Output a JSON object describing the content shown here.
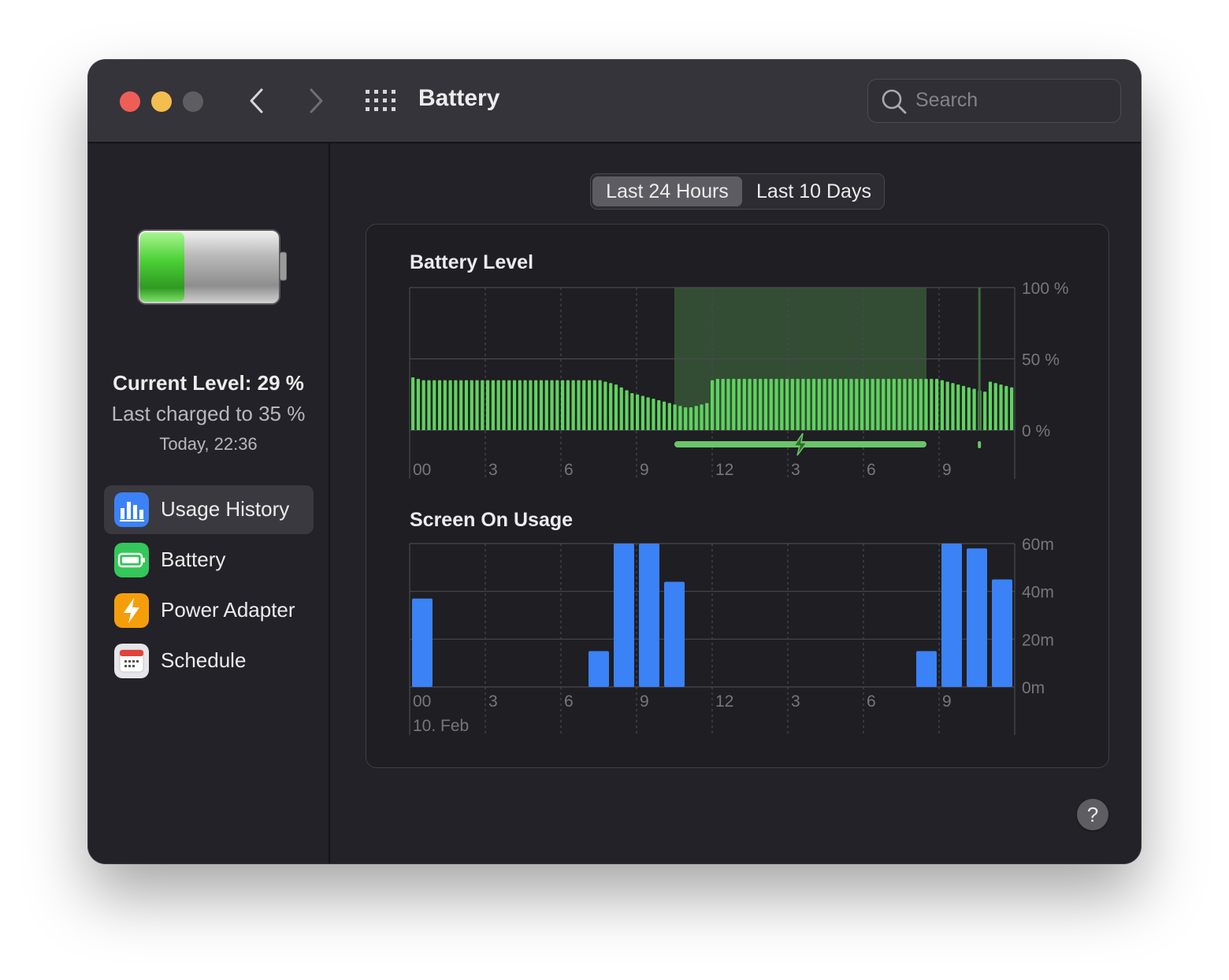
{
  "window": {
    "title": "Battery",
    "search_placeholder": "Search"
  },
  "sidebar": {
    "status": {
      "current_level": "Current Level: 29 %",
      "last_charged": "Last charged to 35 %",
      "charged_time": "Today, 22:36"
    },
    "items": [
      {
        "label": "Usage History",
        "icon": "usage-history-icon",
        "color": "#3b82f6",
        "active": true
      },
      {
        "label": "Battery",
        "icon": "battery-icon",
        "color": "#34c759"
      },
      {
        "label": "Power Adapter",
        "icon": "bolt-icon",
        "color": "#f59e0b"
      },
      {
        "label": "Schedule",
        "icon": "calendar-icon",
        "color": "#e5e5ea"
      }
    ]
  },
  "segmented": {
    "options": [
      "Last 24 Hours",
      "Last 10 Days"
    ],
    "selected": 0
  },
  "help_label": "?",
  "colors": {
    "battery_bar": "#5fd35f",
    "charging_band": "#334d34",
    "screen_bar": "#3a82f6",
    "grid": "#4a4950"
  },
  "chart_data": [
    {
      "type": "bar",
      "title": "Battery Level",
      "x_ticks": [
        "00",
        "3",
        "6",
        "9",
        "12",
        "3",
        "6",
        "9"
      ],
      "y_ticks": [
        "100 %",
        "50 %",
        "0 %"
      ],
      "ylim": [
        0,
        100
      ],
      "charging_span_hours": [
        10.5,
        20.5
      ],
      "charging_marker_hour": 22.6,
      "values_percent_every_quarter_hour": [
        37,
        36,
        35,
        35,
        35,
        35,
        35,
        35,
        35,
        35,
        35,
        35,
        35,
        35,
        35,
        35,
        35,
        35,
        35,
        35,
        35,
        35,
        35,
        35,
        35,
        35,
        35,
        35,
        35,
        35,
        35,
        35,
        35,
        35,
        35,
        35,
        34,
        33,
        32,
        30,
        28,
        26,
        25,
        24,
        23,
        22,
        21,
        20,
        19,
        18,
        17,
        16,
        16,
        17,
        18,
        19,
        35,
        36,
        36,
        36,
        36,
        36,
        36,
        36,
        36,
        36,
        36,
        36,
        36,
        36,
        36,
        36,
        36,
        36,
        36,
        36,
        36,
        36,
        36,
        36,
        36,
        36,
        36,
        36,
        36,
        36,
        36,
        36,
        36,
        36,
        36,
        36,
        36,
        36,
        36,
        36,
        36,
        36,
        36,
        35,
        34,
        33,
        32,
        31,
        30,
        29,
        28,
        27,
        34,
        33,
        32,
        31,
        30
      ]
    },
    {
      "type": "bar",
      "title": "Screen On Usage",
      "x_ticks": [
        "00",
        "3",
        "6",
        "9",
        "12",
        "3",
        "6",
        "9"
      ],
      "x_sublabel": "10. Feb",
      "y_ticks": [
        "60m",
        "40m",
        "20m",
        "0m"
      ],
      "ylim": [
        0,
        60
      ],
      "unit": "minutes",
      "values_minutes_per_hour": [
        37,
        0,
        0,
        0,
        0,
        0,
        0,
        15,
        60,
        60,
        44,
        0,
        0,
        0,
        0,
        0,
        0,
        0,
        0,
        0,
        15,
        60,
        58,
        45
      ]
    }
  ]
}
